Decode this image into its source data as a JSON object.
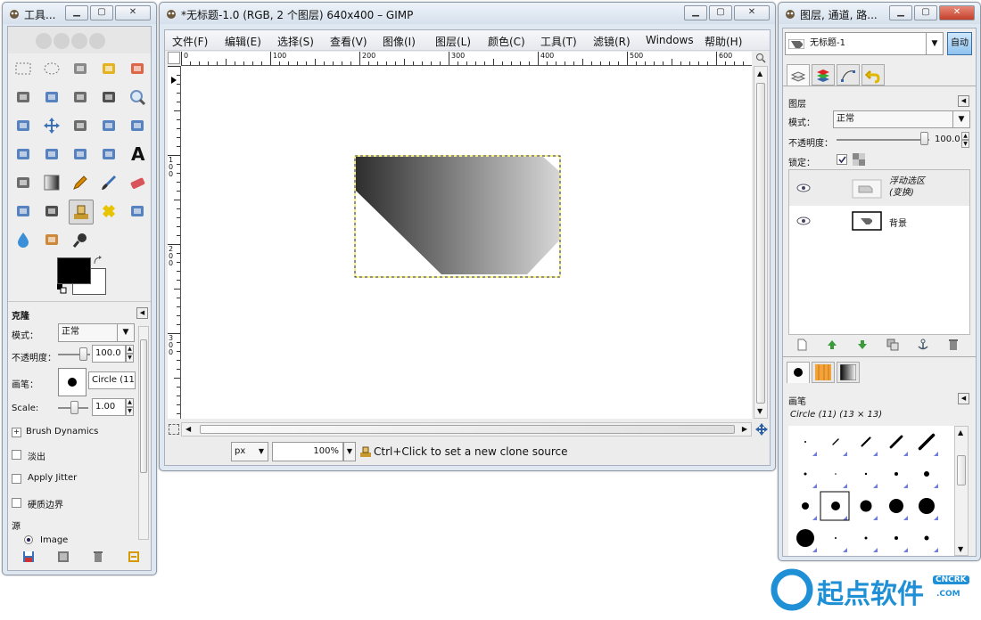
{
  "toolbox": {
    "title": "工具...",
    "options_title": "克隆",
    "mode_label": "模式：",
    "mode_value": "正常",
    "opacity_label": "不透明度：",
    "opacity_value": "100.0",
    "brush_label": "画笔：",
    "brush_value": "Circle (11",
    "scale_label": "Scale:",
    "scale_value": "1.00",
    "brush_dynamics": "Brush Dynamics",
    "fade_label": "淡出",
    "jitter_label": "Apply Jitter",
    "hard_edge_label": "硬质边界",
    "source_label": "源",
    "source_image": "Image"
  },
  "image_window": {
    "title": "*无标题-1.0 (RGB, 2 个图层) 640x400 – GIMP",
    "menu": [
      "文件(F)",
      "编辑(E)",
      "选择(S)",
      "查看(V)",
      "图像(I)",
      "图层(L)",
      "颜色(C)",
      "工具(T)",
      "滤镜(R)",
      "Windows",
      "帮助(H)"
    ],
    "ruler_h": [
      "0",
      "100",
      "200",
      "300",
      "400",
      "500",
      "600"
    ],
    "ruler_v": [
      "1\n0\n0",
      "2\n0\n0",
      "3\n0\n0"
    ],
    "unit": "px",
    "zoom": "100",
    "zoom_suffix": "%",
    "status": "Ctrl+Click to set a new clone source"
  },
  "layers_dock": {
    "title": "图层, 通道, 路...",
    "image_select": "无标题-1",
    "auto_button": "自动",
    "panel_title": "图层",
    "mode_label": "模式：",
    "mode_value": "正常",
    "opacity_label": "不透明度：",
    "opacity_value": "100.0",
    "lock_label": "锁定：",
    "layers": [
      {
        "name": "浮动选区\n(变换)"
      },
      {
        "name": "背景"
      }
    ],
    "brushes_title": "画笔",
    "brush_info": "Circle (11) (13 × 13)"
  },
  "watermark": {
    "text": "起点软件",
    "sub": "CNCRK",
    "sub2": ".COM"
  }
}
